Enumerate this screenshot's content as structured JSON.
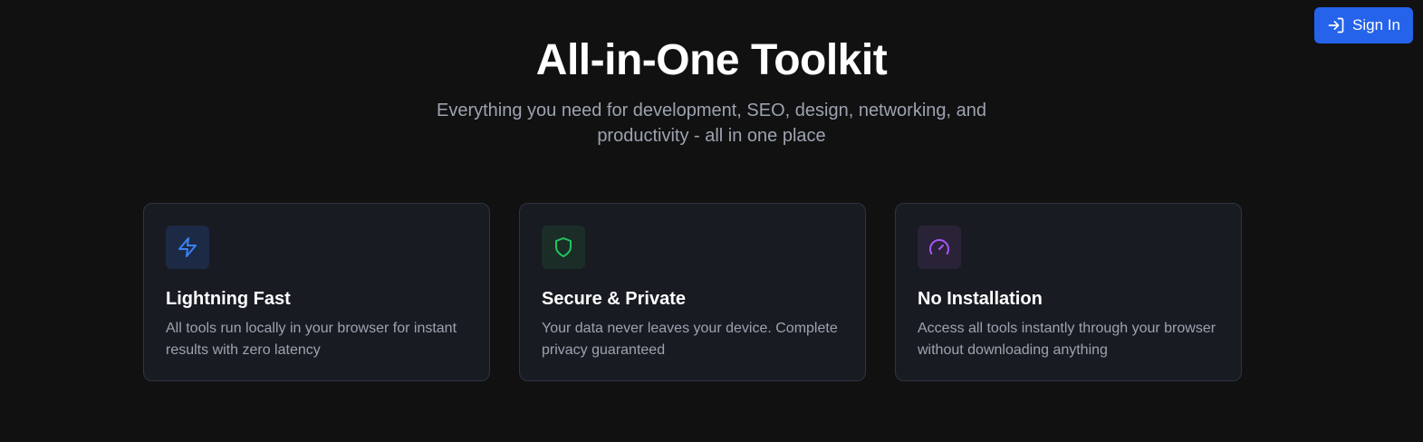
{
  "header": {
    "signin_label": "Sign In",
    "signin_icon": "log-in-icon"
  },
  "hero": {
    "title": "All-in-One Toolkit",
    "subtitle": "Everything you need for development, SEO, design, networking, and productivity - all in one place"
  },
  "features": [
    {
      "title": "Lightning Fast",
      "description": "All tools run locally in your browser for instant results with zero latency",
      "icon": "lightning-icon",
      "icon_color": "#3b82f6",
      "icon_bg": "#1c2a45"
    },
    {
      "title": "Secure & Private",
      "description": "Your data never leaves your device. Complete privacy guaranteed",
      "icon": "shield-icon",
      "icon_color": "#22c55e",
      "icon_bg": "#1a2e27"
    },
    {
      "title": "No Installation",
      "description": "Access all tools instantly through your browser without downloading anything",
      "icon": "gauge-icon",
      "icon_color": "#a855f7",
      "icon_bg": "#2a2338"
    }
  ],
  "colors": {
    "background": "#111112",
    "accent": "#2563eb",
    "card_bg": "#181b22",
    "card_border": "#2e3440",
    "muted_text": "#9ca3af"
  }
}
